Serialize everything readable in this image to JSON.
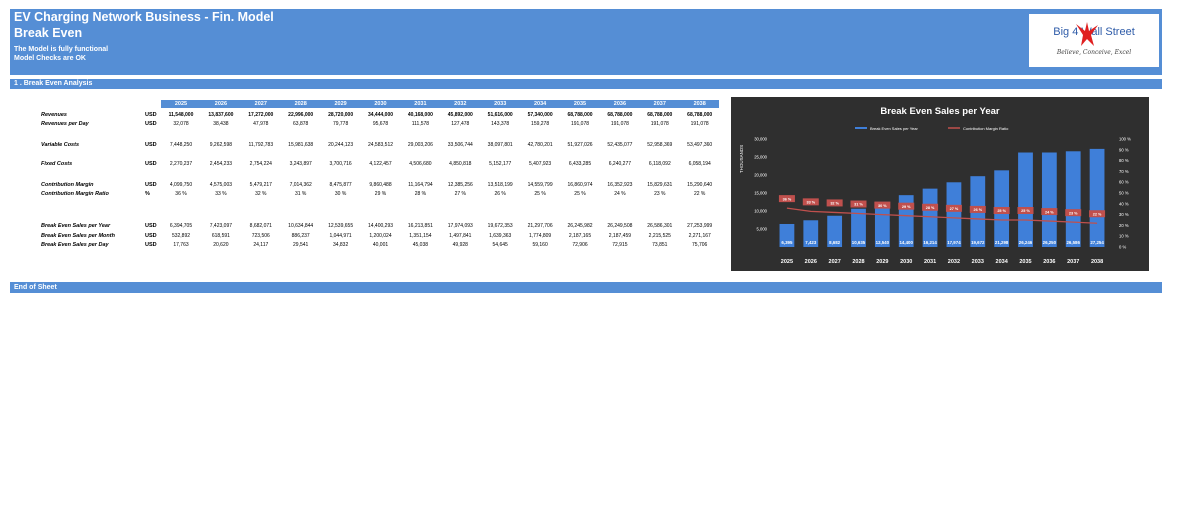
{
  "header": {
    "title": "EV Charging Network Business - Fin. Model",
    "subtitle": "Break Even",
    "note1": "The Model is fully functional",
    "note2": "Model Checks are OK"
  },
  "logo": {
    "line1": "Big 4     Wall Street",
    "tagline": "Believe, Conceive, Excel"
  },
  "section": "1 .  Break Even Analysis",
  "end_label": "End of Sheet",
  "years": [
    "2025",
    "2026",
    "2027",
    "2028",
    "2029",
    "2030",
    "2031",
    "2032",
    "2033",
    "2034",
    "2035",
    "2036",
    "2037",
    "2038"
  ],
  "rows": [
    {
      "label": "Revenues",
      "unit": "USD",
      "bold": true,
      "values": [
        "11,548,000",
        "13,837,600",
        "17,272,000",
        "22,996,000",
        "28,720,000",
        "34,444,000",
        "40,168,000",
        "45,892,000",
        "51,616,000",
        "57,340,000",
        "68,788,000",
        "68,788,000",
        "68,788,000",
        "68,788,000"
      ]
    },
    {
      "label": "Revenues per Day",
      "unit": "USD",
      "bold": false,
      "values": [
        "32,078",
        "38,438",
        "47,978",
        "63,878",
        "79,778",
        "95,678",
        "111,578",
        "127,478",
        "143,378",
        "159,278",
        "191,078",
        "191,078",
        "191,078",
        "191,078"
      ]
    },
    {
      "label": "Variable Costs",
      "unit": "USD",
      "bold": false,
      "values": [
        "7,448,250",
        "9,262,598",
        "11,792,783",
        "15,981,638",
        "20,244,123",
        "24,583,512",
        "29,003,206",
        "33,506,744",
        "38,097,801",
        "42,780,201",
        "51,927,026",
        "52,435,077",
        "52,958,369",
        "53,497,360"
      ]
    },
    {
      "label": "Fixed Costs",
      "unit": "USD",
      "bold": false,
      "values": [
        "2,270,237",
        "2,454,233",
        "2,754,224",
        "3,243,897",
        "3,700,716",
        "4,122,457",
        "4,506,680",
        "4,850,818",
        "5,152,177",
        "5,407,923",
        "6,433,285",
        "6,240,277",
        "6,118,092",
        "6,058,194"
      ]
    },
    {
      "label": "Contribution Margin",
      "unit": "USD",
      "bold": false,
      "values": [
        "4,099,750",
        "4,575,003",
        "5,479,217",
        "7,014,362",
        "8,475,877",
        "9,860,488",
        "11,164,794",
        "12,385,256",
        "13,518,199",
        "14,559,799",
        "16,860,974",
        "16,352,923",
        "15,829,631",
        "15,290,640"
      ]
    },
    {
      "label": "Contribution Margin Ratio",
      "unit": "%",
      "bold": false,
      "values": [
        "36 %",
        "33 %",
        "32 %",
        "31 %",
        "30 %",
        "29 %",
        "28 %",
        "27 %",
        "26 %",
        "25 %",
        "25 %",
        "24 %",
        "23 %",
        "22 %"
      ]
    },
    {
      "label": "Break Even Sales per Year",
      "unit": "USD",
      "bold": false,
      "values": [
        "6,394,705",
        "7,423,097",
        "8,682,071",
        "10,634,844",
        "12,539,655",
        "14,400,293",
        "16,213,851",
        "17,974,093",
        "19,672,353",
        "21,297,706",
        "26,245,982",
        "26,249,508",
        "26,586,301",
        "27,253,999"
      ]
    },
    {
      "label": "Break Even Sales per Month",
      "unit": "USD",
      "bold": false,
      "values": [
        "532,892",
        "618,591",
        "723,506",
        "886,237",
        "1,044,971",
        "1,200,024",
        "1,351,154",
        "1,497,841",
        "1,639,363",
        "1,774,809",
        "2,187,165",
        "2,187,459",
        "2,215,525",
        "2,271,167"
      ]
    },
    {
      "label": "Break Even Sales per Day",
      "unit": "USD",
      "bold": false,
      "values": [
        "17,763",
        "20,620",
        "24,117",
        "29,541",
        "34,832",
        "40,001",
        "45,038",
        "49,928",
        "54,645",
        "59,160",
        "72,906",
        "72,915",
        "73,851",
        "75,706"
      ]
    }
  ],
  "colors": {
    "header_blue": "#558ED5",
    "chart_bg": "#2F2F2F",
    "bar": "#3F7FD9",
    "line": "#C0504D"
  },
  "chart_data": {
    "type": "bar",
    "title": "Break Even Sales per Year",
    "ylabel": "THOUSANDS",
    "categories": [
      "2025",
      "2026",
      "2027",
      "2028",
      "2029",
      "2030",
      "2031",
      "2032",
      "2033",
      "2034",
      "2035",
      "2036",
      "2037",
      "2038"
    ],
    "ylim": [
      0,
      30000
    ],
    "y2lim": [
      0,
      100
    ],
    "yticks": [
      "5,000",
      "10,000",
      "15,000",
      "20,000",
      "25,000",
      "30,000"
    ],
    "y2ticks": [
      "0 %",
      "10 %",
      "20 %",
      "30 %",
      "40 %",
      "50 %",
      "60 %",
      "70 %",
      "80 %",
      "90 %",
      "100 %"
    ],
    "legend": "top",
    "series": [
      {
        "name": "Break Even Sales per Year",
        "type": "bar",
        "values": [
          6395,
          7423,
          8682,
          10635,
          12540,
          14400,
          16214,
          17974,
          19672,
          21298,
          26246,
          26250,
          26586,
          27254
        ],
        "labels": [
          "6,395",
          "7,423",
          "8,682",
          "10,635",
          "12,540",
          "14,400",
          "16,214",
          "17,974",
          "19,672",
          "21,298",
          "26,246",
          "26,250",
          "26,586",
          "27,254"
        ]
      },
      {
        "name": "Contribution Margin Ratio",
        "type": "line",
        "axis": "right",
        "values": [
          36,
          33,
          32,
          31,
          30,
          29,
          28,
          27,
          26,
          25,
          25,
          24,
          23,
          22
        ],
        "labels": [
          "36 %",
          "33 %",
          "32 %",
          "31 %",
          "30 %",
          "29 %",
          "28 %",
          "27 %",
          "26 %",
          "25 %",
          "25 %",
          "24 %",
          "23 %",
          "22 %"
        ]
      }
    ]
  }
}
